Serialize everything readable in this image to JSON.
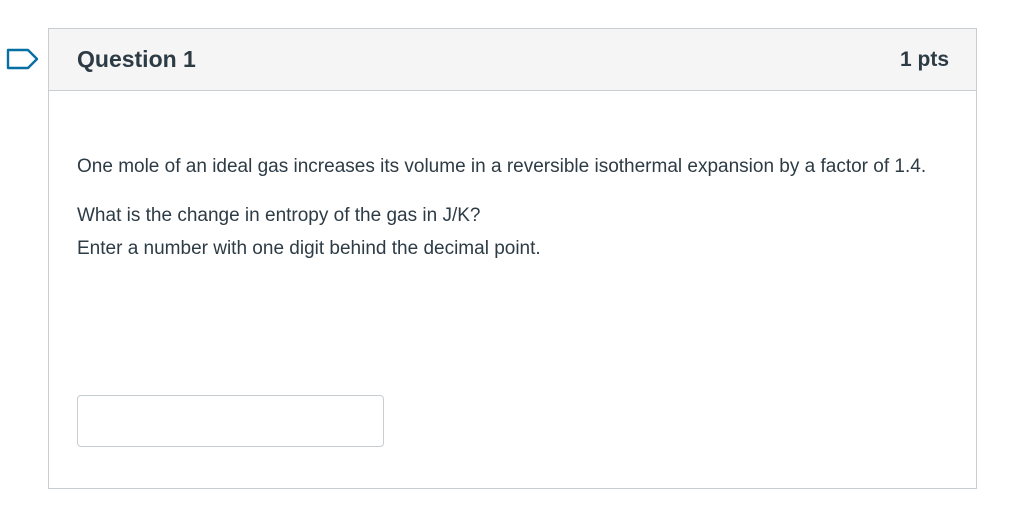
{
  "question": {
    "flag_icon": "flag-outline-icon",
    "title": "Question 1",
    "points": "1 pts",
    "text_para1": "One mole of an ideal gas increases its volume in a reversible isothermal expansion by a factor of 1.4.",
    "text_line2": "What is the change in entropy of the gas in J/K?",
    "text_line3": "Enter a number with one digit behind the decimal point.",
    "answer_value": ""
  },
  "colors": {
    "flag": "#0770a3",
    "border": "#c7cdd1",
    "header_bg": "#f5f5f5",
    "text": "#2d3b45"
  }
}
